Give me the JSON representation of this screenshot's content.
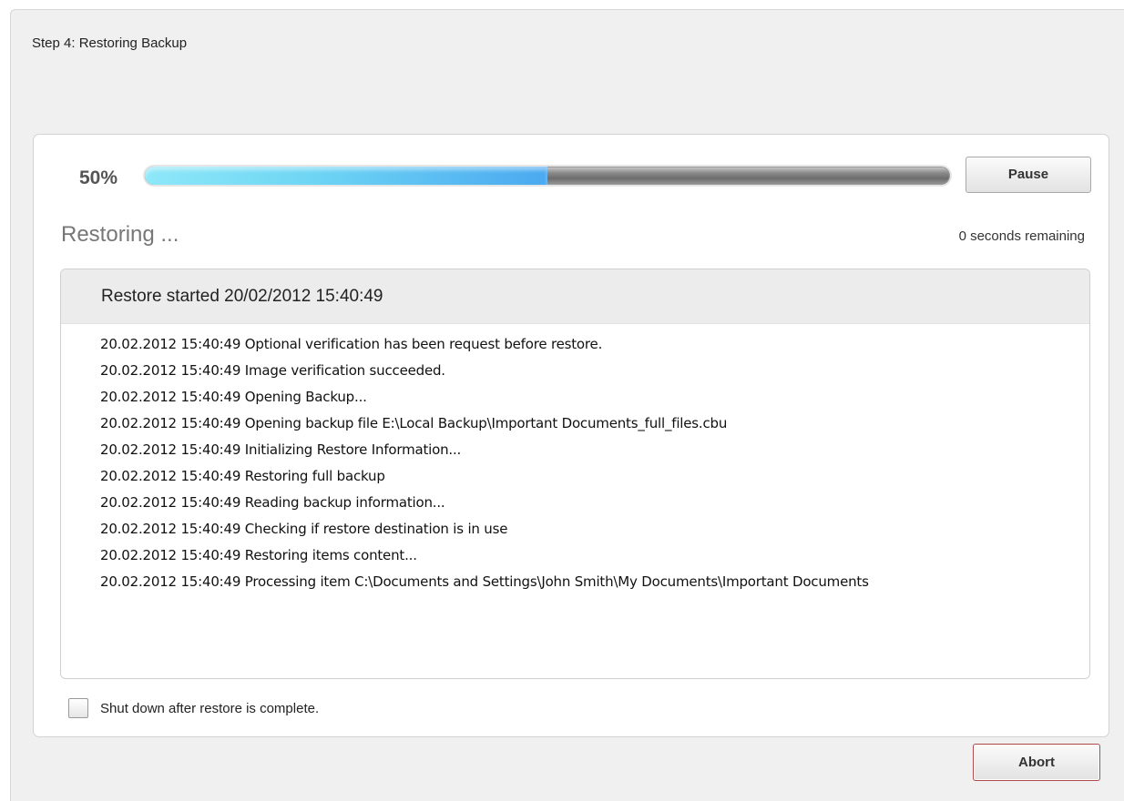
{
  "step_title": "Step 4: Restoring Backup",
  "progress": {
    "percent_label": "50%",
    "value": 0.5,
    "fill_color": "#4aa9f0",
    "track_color": "#777777"
  },
  "buttons": {
    "pause_label": "Pause",
    "abort_label": "Abort"
  },
  "status": {
    "text": "Restoring ...",
    "remaining": "0 seconds remaining"
  },
  "log": {
    "header": "Restore started 20/02/2012 15:40:49",
    "lines": [
      "20.02.2012 15:40:49 Optional verification has been request before restore.",
      "20.02.2012 15:40:49 Image verification succeeded.",
      "20.02.2012 15:40:49 Opening Backup...",
      "20.02.2012 15:40:49 Opening backup file E:\\Local Backup\\Important Documents_full_files.cbu",
      "20.02.2012 15:40:49 Initializing Restore Information...",
      "20.02.2012 15:40:49 Restoring full backup",
      "20.02.2012 15:40:49 Reading backup information...",
      "20.02.2012 15:40:49 Checking if restore destination is in use",
      "20.02.2012 15:40:49 Restoring items content...",
      "20.02.2012 15:40:49 Processing item C:\\Documents and Settings\\John Smith\\My Documents\\Important Documents"
    ]
  },
  "shutdown_option": {
    "label": "Shut down after restore is complete.",
    "checked": false
  },
  "colors": {
    "abort_border": "#b04a4a",
    "background": "#f0f0f0"
  }
}
